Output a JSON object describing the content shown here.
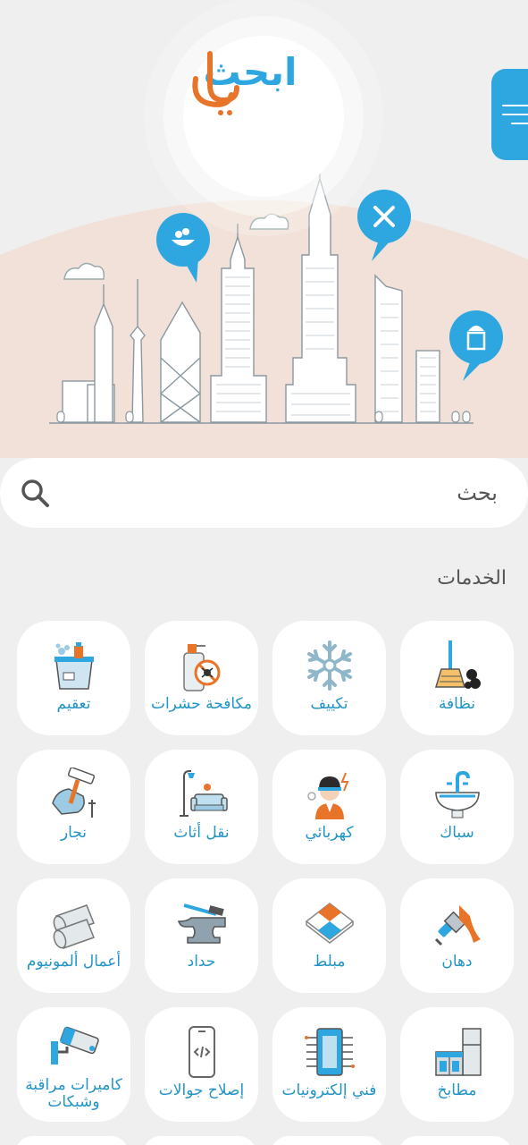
{
  "header": {
    "logo_text": "ابحث لي",
    "menu_icon": "hamburger-icon"
  },
  "search": {
    "placeholder": "بحث",
    "icon": "search-icon"
  },
  "services": {
    "title": "الخدمات",
    "items": [
      {
        "label": "نظافة",
        "icon": "broom-icon"
      },
      {
        "label": "تكييف",
        "icon": "snowflake-icon"
      },
      {
        "label": "مكافحة حشرات",
        "icon": "pest-spray-icon"
      },
      {
        "label": "تعقيم",
        "icon": "sanitize-bucket-icon"
      },
      {
        "label": "سباك",
        "icon": "sink-icon"
      },
      {
        "label": "كهربائي",
        "icon": "electrician-icon"
      },
      {
        "label": "نقل أثاث",
        "icon": "sofa-lamp-icon"
      },
      {
        "label": "نجار",
        "icon": "hammer-hand-icon"
      },
      {
        "label": "دهان",
        "icon": "paint-brush-icon"
      },
      {
        "label": "مبلط",
        "icon": "tiles-icon"
      },
      {
        "label": "حداد",
        "icon": "anvil-icon"
      },
      {
        "label": "أعمال ألمونيوم",
        "icon": "aluminum-pipes-icon"
      },
      {
        "label": "مطابخ",
        "icon": "kitchen-cabinet-icon"
      },
      {
        "label": "فني إلكترونيات",
        "icon": "circuit-board-icon"
      },
      {
        "label": "إصلاح جوالات",
        "icon": "phone-code-icon"
      },
      {
        "label": "كاميرات مراقبة وشبكات",
        "icon": "cctv-camera-icon"
      }
    ]
  },
  "colors": {
    "accent_blue": "#2ea6e0",
    "logo_orange": "#e8742a",
    "label_blue": "#2395c5",
    "hero_peach": "#f1e1d8"
  }
}
